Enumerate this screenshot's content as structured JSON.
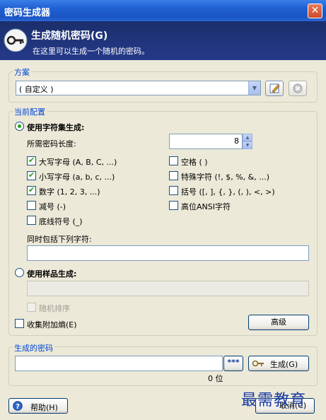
{
  "window": {
    "title": "密码生成器",
    "close_glyph": "✕"
  },
  "banner": {
    "title": "生成随机密码(G)",
    "subtitle": "在这里可以生成一个随机的密码。"
  },
  "scheme": {
    "group_label": "方案",
    "selected": "( 自定义 )"
  },
  "config": {
    "group_label": "当前配置",
    "use_charset_label": "使用字符集生成:",
    "length_label": "所需密码长度:",
    "length_value": "8",
    "charsets": [
      {
        "label": "大写字母 (A, B, C, ...)",
        "checked": true
      },
      {
        "label": "小写字母 (a, b, c, ...)",
        "checked": true
      },
      {
        "label": "数字 (1, 2, 3, ...)",
        "checked": true
      },
      {
        "label": "减号 (-)",
        "checked": false
      },
      {
        "label": "底线符号 (_)",
        "checked": false
      },
      {
        "label": "空格 ( )",
        "checked": false
      },
      {
        "label": "特殊字符 (!, $, %, &, ...)",
        "checked": false
      },
      {
        "label": "括号 ([, ], {, }, (, ), <, >)",
        "checked": false
      },
      {
        "label": "高位ANSI字符",
        "checked": false
      }
    ],
    "include_label": "同时包括下列字符:",
    "use_pattern_label": "使用样品生成:",
    "random_order_label": "随机排序",
    "collect_entropy_label": "收集附加熵(E)",
    "advanced_label": "高级"
  },
  "generated": {
    "group_label": "生成的密码",
    "mask_label": "***",
    "generate_label": "生成(G)",
    "bits_label": "0 位"
  },
  "footer": {
    "help_label": "帮助(H)",
    "cancel_label": "取消(C)"
  },
  "watermark": "最需教育"
}
